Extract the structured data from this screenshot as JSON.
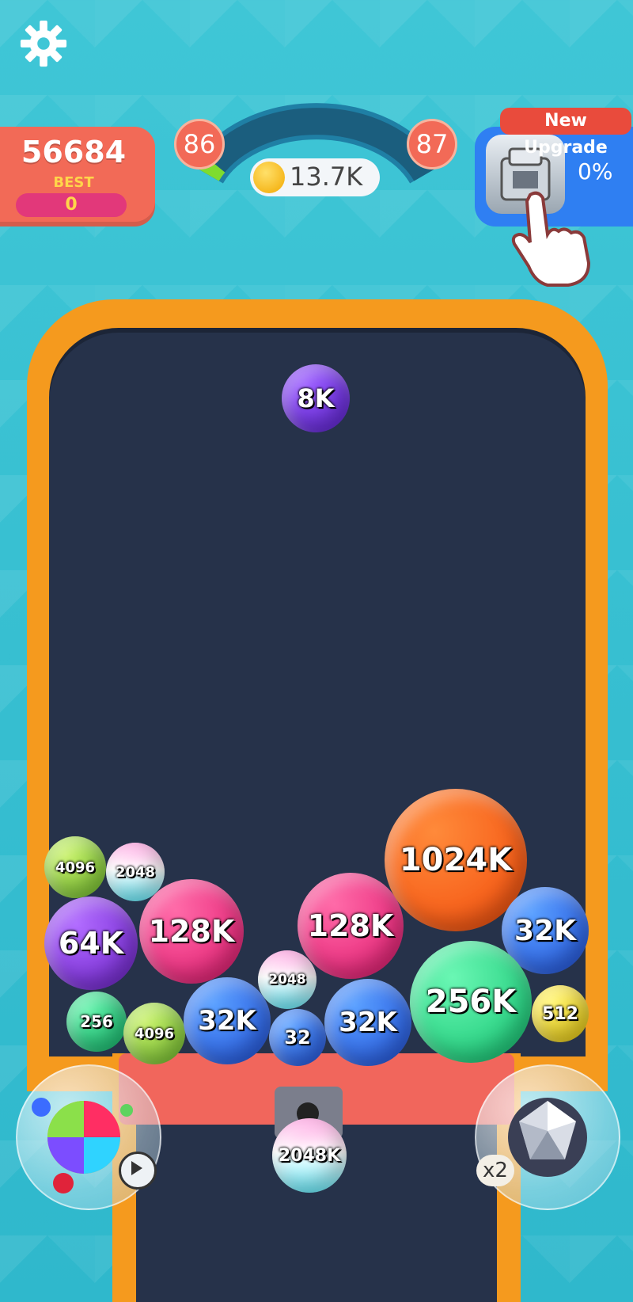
{
  "header": {
    "score": "56684",
    "best_label": "BEST",
    "best_value": "0",
    "level_current": "86",
    "level_next": "87",
    "coins": "13.7K",
    "level_progress": 0.05
  },
  "upgrade": {
    "tag": "New Upgrade",
    "percent": "0%"
  },
  "balls": {
    "falling": "8K",
    "b1": "4096",
    "b2": "2048",
    "b3": "64K",
    "b4": "128K",
    "b5": "128K",
    "b6": "1024K",
    "b7": "32K",
    "b8": "2048",
    "b9": "256",
    "b10": "4096",
    "b11": "32K",
    "b12": "32",
    "b13": "32K",
    "b14": "256K",
    "b15": "512",
    "next": "2048K"
  },
  "powerups": {
    "bomb_multiplier": "x2"
  },
  "colors": {
    "background": "#3fc6d6",
    "frame": "#f59a1e",
    "board": "#26324a",
    "score_panel": "#f26a57",
    "upgrade_panel": "#2f7ff2"
  }
}
